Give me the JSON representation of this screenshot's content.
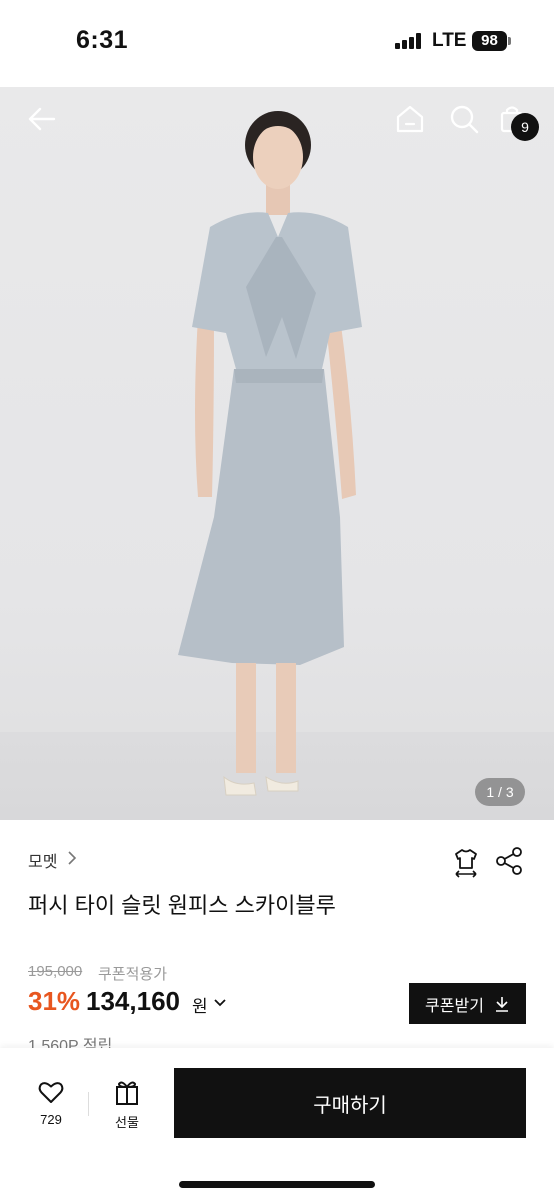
{
  "status_bar": {
    "time": "6:31",
    "network": "LTE",
    "battery": "98"
  },
  "hero": {
    "page_indicator": "1 / 3",
    "cart_badge": "9",
    "icons": [
      "back-arrow-icon",
      "home-icon",
      "search-icon",
      "shopping-bag-icon"
    ]
  },
  "product": {
    "brand": "모멧",
    "title": "퍼시 타이 슬릿 원피스 스카이블루",
    "original_price": "195,000",
    "coupon_note": "쿠폰적용가",
    "discount": "31%",
    "price": "134,160",
    "currency": "원",
    "coupon_button": "쿠폰받기",
    "points": "1,560P 적립"
  },
  "bottom_bar": {
    "like_count": "729",
    "gift_label": "선물",
    "buy_label": "구매하기"
  },
  "colors": {
    "discount": "#e8561f",
    "dark": "#111111",
    "muted": "#9a9a9a"
  }
}
